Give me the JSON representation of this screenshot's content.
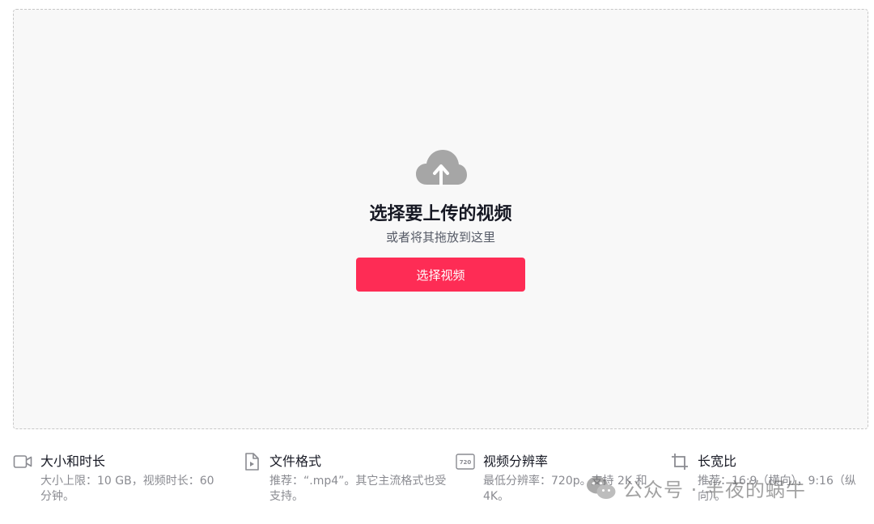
{
  "upload": {
    "icon": "cloud-upload-icon",
    "title": "选择要上传的视频",
    "subtitle": "或者将其拖放到这里",
    "button_label": "选择视频",
    "button_color": "#fe2c55"
  },
  "requirements": [
    {
      "icon": "video-camera-icon",
      "title": "大小和时长",
      "description": "大小上限：10 GB，视频时长：60 分钟。"
    },
    {
      "icon": "file-play-icon",
      "title": "文件格式",
      "description": "推荐：“.mp4”。其它主流格式也受支持。"
    },
    {
      "icon": "resolution-720-icon",
      "title": "视频分辨率",
      "description": "最低分辨率：720p。支持 2K 和 4K。"
    },
    {
      "icon": "crop-icon",
      "title": "长宽比",
      "description": "推荐：16:9（横向），9:16（纵向）。"
    }
  ],
  "watermark": {
    "icon": "wechat-icon",
    "text": "公众号 · 半夜的蜗牛"
  }
}
